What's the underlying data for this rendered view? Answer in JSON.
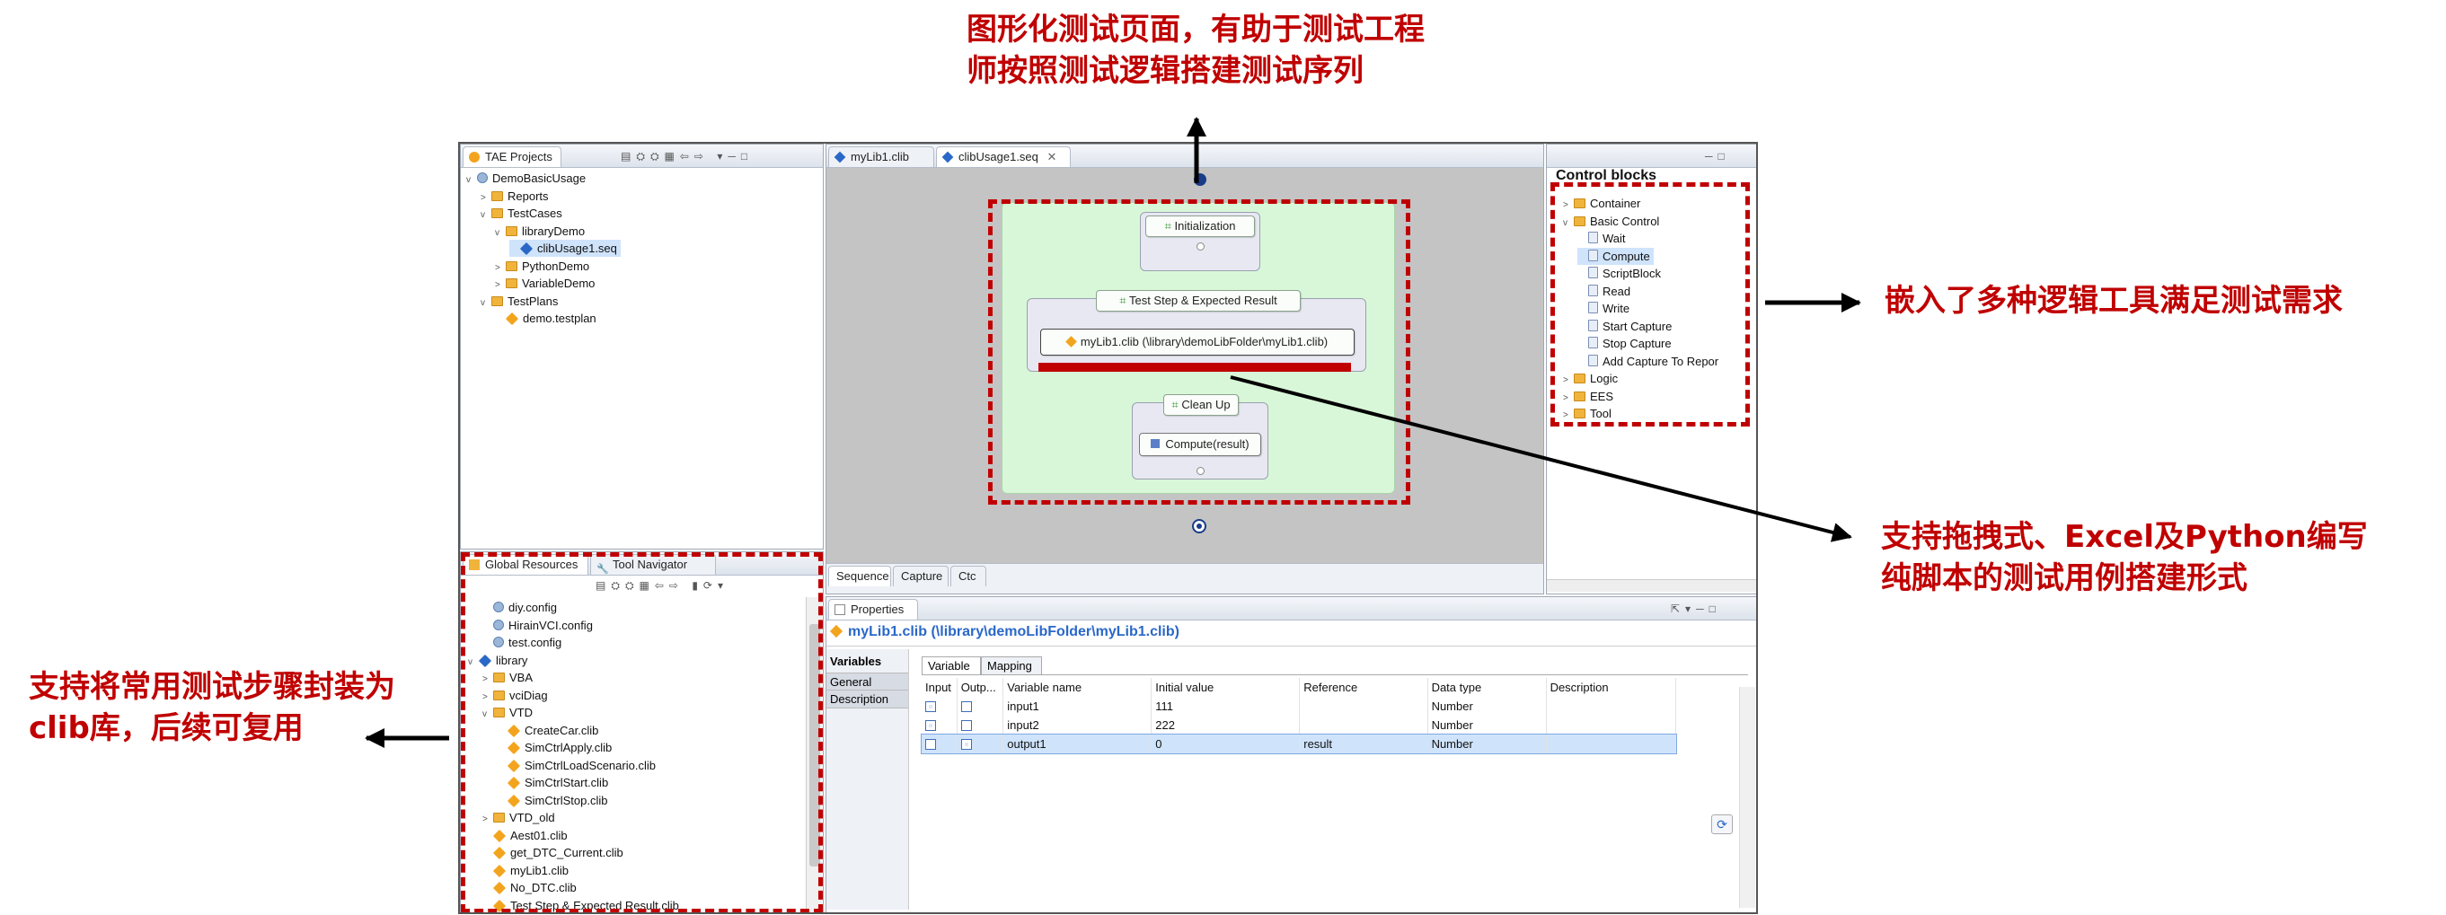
{
  "annotations": {
    "top": [
      "图形化测试页面，有助于测试工程",
      "师按照测试逻辑搭建测试序列"
    ],
    "right_top": "嵌入了多种逻辑工具满足测试需求",
    "right_bottom": [
      "支持拖拽式、Excel及Python编写",
      "纯脚本的测试用例搭建形式"
    ],
    "left": [
      "支持将常用测试步骤封装为",
      "clib库，后续可复用"
    ]
  },
  "projects_panel": {
    "title": "TAE Projects",
    "tree": [
      {
        "label": "DemoBasicUsage",
        "level": 0,
        "icon": "project-icon",
        "twisty": "v"
      },
      {
        "label": "Reports",
        "level": 1,
        "icon": "reports-folder-icon",
        "twisty": ">"
      },
      {
        "label": "TestCases",
        "level": 1,
        "icon": "testcases-icon",
        "twisty": "v"
      },
      {
        "label": "libraryDemo",
        "level": 2,
        "icon": "folder-icon",
        "twisty": "v"
      },
      {
        "label": "clibUsage1.seq",
        "level": 3,
        "icon": "seq-file-icon",
        "twisty": "",
        "selected": true
      },
      {
        "label": "PythonDemo",
        "level": 2,
        "icon": "folder-icon",
        "twisty": ">"
      },
      {
        "label": "VariableDemo",
        "level": 2,
        "icon": "folder-icon",
        "twisty": ">"
      },
      {
        "label": "TestPlans",
        "level": 1,
        "icon": "testplans-icon",
        "twisty": "v"
      },
      {
        "label": "demo.testplan",
        "level": 2,
        "icon": "testplan-file-icon",
        "twisty": ""
      }
    ]
  },
  "editor": {
    "tabs": [
      {
        "label": "myLib1.clib",
        "active": false
      },
      {
        "label": "clibUsage1.seq",
        "active": true
      }
    ],
    "blocks": {
      "init": "Initialization",
      "step": "Test Step & Expected Result",
      "call": "myLib1.clib (\\library\\demoLibFolder\\myLib1.clib)",
      "cleanup": "Clean Up",
      "compute": "Compute(result)"
    },
    "bottom_tabs": [
      "Sequence",
      "Capture",
      "Ctc"
    ]
  },
  "control_blocks": {
    "title": "Control blocks",
    "items": [
      {
        "label": "Container",
        "level": 0,
        "twisty": ">",
        "icon": "folder-icon"
      },
      {
        "label": "Basic Control",
        "level": 0,
        "twisty": "v",
        "icon": "folder-icon"
      },
      {
        "label": "Wait",
        "level": 1,
        "icon": "wait-icon"
      },
      {
        "label": "Compute",
        "level": 1,
        "icon": "compute-icon",
        "selected": true
      },
      {
        "label": "ScriptBlock",
        "level": 1,
        "icon": "script-icon"
      },
      {
        "label": "Read",
        "level": 1,
        "icon": "read-icon"
      },
      {
        "label": "Write",
        "level": 1,
        "icon": "write-icon"
      },
      {
        "label": "Start Capture",
        "level": 1,
        "icon": "start-capture-icon"
      },
      {
        "label": "Stop Capture",
        "level": 1,
        "icon": "stop-capture-icon"
      },
      {
        "label": "Add Capture To Repor",
        "level": 1,
        "icon": "add-capture-icon"
      },
      {
        "label": "Logic",
        "level": 0,
        "twisty": ">",
        "icon": "folder-icon"
      },
      {
        "label": "EES",
        "level": 0,
        "twisty": ">",
        "icon": "folder-icon"
      },
      {
        "label": "Tool",
        "level": 0,
        "twisty": ">",
        "icon": "folder-icon"
      }
    ]
  },
  "resources_panel": {
    "tabs": [
      "Global Resources",
      "Tool Navigator"
    ],
    "tree": [
      {
        "label": "diy.config",
        "level": 1,
        "icon": "config-icon"
      },
      {
        "label": "HirainVCI.config",
        "level": 1,
        "icon": "config-icon"
      },
      {
        "label": "test.config",
        "level": 1,
        "icon": "config-icon"
      },
      {
        "label": "library",
        "level": 0,
        "twisty": "v",
        "icon": "library-icon"
      },
      {
        "label": "VBA",
        "level": 1,
        "twisty": ">",
        "icon": "folder-icon"
      },
      {
        "label": "vciDiag",
        "level": 1,
        "twisty": ">",
        "icon": "folder-icon"
      },
      {
        "label": "VTD",
        "level": 1,
        "twisty": "v",
        "icon": "folder-icon"
      },
      {
        "label": "CreateCar.clib",
        "level": 2,
        "icon": "clib-icon"
      },
      {
        "label": "SimCtrlApply.clib",
        "level": 2,
        "icon": "clib-icon"
      },
      {
        "label": "SimCtrlLoadScenario.clib",
        "level": 2,
        "icon": "clib-icon"
      },
      {
        "label": "SimCtrlStart.clib",
        "level": 2,
        "icon": "clib-icon"
      },
      {
        "label": "SimCtrlStop.clib",
        "level": 2,
        "icon": "clib-icon"
      },
      {
        "label": "VTD_old",
        "level": 1,
        "twisty": ">",
        "icon": "folder-icon"
      },
      {
        "label": "Aest01.clib",
        "level": 1,
        "icon": "clib-icon"
      },
      {
        "label": "get_DTC_Current.clib",
        "level": 1,
        "icon": "clib-icon"
      },
      {
        "label": "myLib1.clib",
        "level": 1,
        "icon": "clib-icon"
      },
      {
        "label": "No_DTC.clib",
        "level": 1,
        "icon": "clib-icon"
      },
      {
        "label": "Test Step & Expected Result.clib",
        "level": 1,
        "icon": "clib-icon"
      }
    ]
  },
  "properties": {
    "tab": "Properties",
    "header": "myLib1.clib (\\library\\demoLibFolder\\myLib1.clib)",
    "side_tabs": [
      "Variables",
      "General",
      "Description"
    ],
    "inner_tabs": [
      "Variable",
      "Mapping"
    ],
    "columns": [
      "Input",
      "Outp...",
      "Variable name",
      "Initial value",
      "Reference",
      "Data type",
      "Description"
    ],
    "rows": [
      {
        "input": true,
        "output": false,
        "name": "input1",
        "initial": "111",
        "reference": "",
        "type": "Number",
        "description": ""
      },
      {
        "input": true,
        "output": false,
        "name": "input2",
        "initial": "222",
        "reference": "",
        "type": "Number",
        "description": ""
      },
      {
        "input": false,
        "output": true,
        "name": "output1",
        "initial": "0",
        "reference": "result",
        "type": "Number",
        "description": ""
      }
    ]
  },
  "colors": {
    "annotation_red": "#c00000",
    "canvas_grey": "#c4c4c4",
    "sequence_green": "#d8f7d8",
    "selection_blue": "#cfe3fb"
  }
}
